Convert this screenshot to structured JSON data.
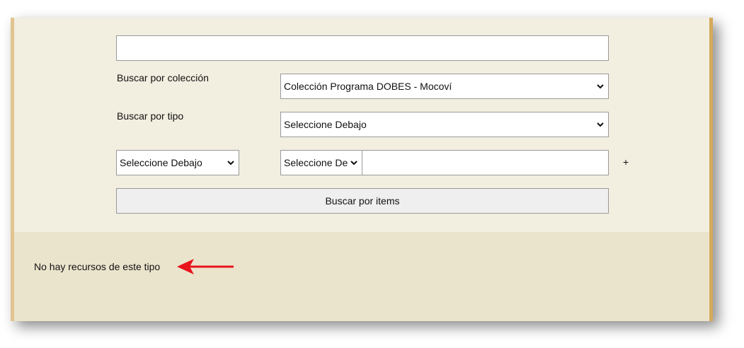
{
  "search": {
    "query_value": "",
    "query_placeholder": ""
  },
  "collection": {
    "label": "Buscar por colección",
    "selected": "Colección Programa DOBES - Mocoví"
  },
  "type": {
    "label": "Buscar por tipo",
    "selected": "Seleccione Debajo"
  },
  "filter": {
    "field_selected": "Seleccione Debajo",
    "operator_selected": "Seleccione Debajo",
    "value": "",
    "add_label": "+"
  },
  "submit": {
    "label": "Buscar por items"
  },
  "results": {
    "message": "No hay recursos de este tipo"
  },
  "colors": {
    "form_bg": "#f2eee0",
    "results_bg": "#ebe4cd",
    "arrow": "#e8131b"
  },
  "icons": {
    "dropdown": "chevron-down-icon",
    "annotation": "arrow-left-icon"
  }
}
